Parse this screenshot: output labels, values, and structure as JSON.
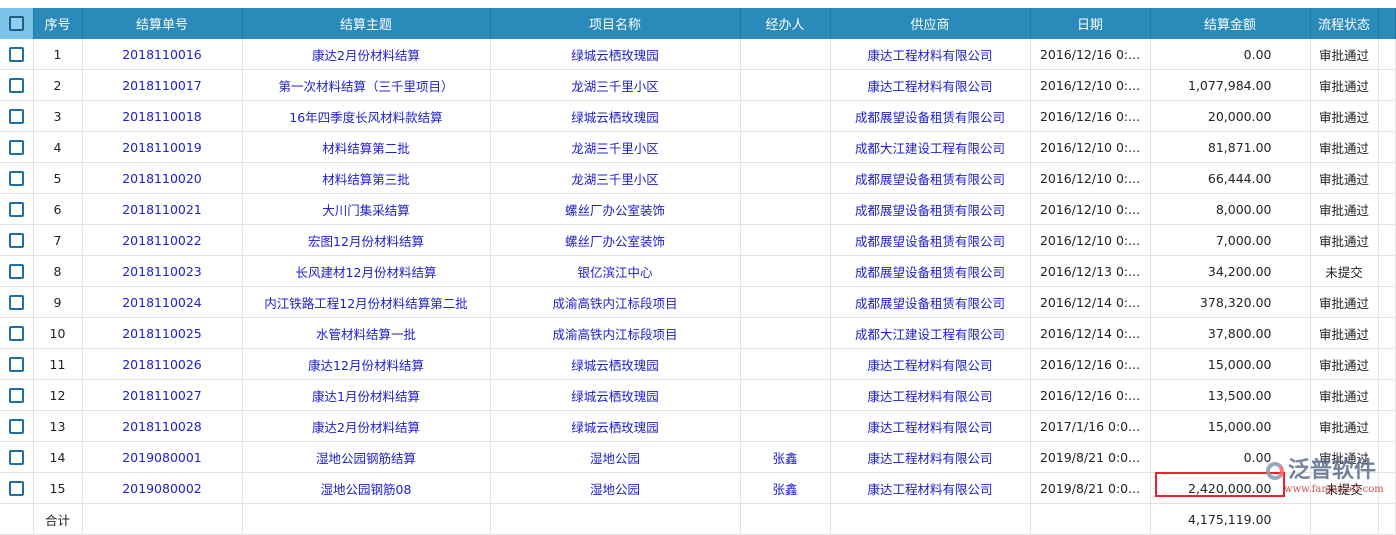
{
  "columns": [
    "序号",
    "结算单号",
    "结算主题",
    "项目名称",
    "经办人",
    "供应商",
    "日期",
    "结算金额",
    "流程状态"
  ],
  "rows": [
    [
      "1",
      "2018110016",
      "康达2月份材料结算",
      "绿城云栖玫瑰园",
      "",
      "康达工程材料有限公司",
      "2016/12/16 0:...",
      "0.00",
      "审批通过"
    ],
    [
      "2",
      "2018110017",
      "第一次材料结算（三千里项目）",
      "龙湖三千里小区",
      "",
      "康达工程材料有限公司",
      "2016/12/10 0:...",
      "1,077,984.00",
      "审批通过"
    ],
    [
      "3",
      "2018110018",
      "16年四季度长风材料款结算",
      "绿城云栖玫瑰园",
      "",
      "成都展望设备租赁有限公司",
      "2016/12/16 0:...",
      "20,000.00",
      "审批通过"
    ],
    [
      "4",
      "2018110019",
      "材料结算第二批",
      "龙湖三千里小区",
      "",
      "成都大江建设工程有限公司",
      "2016/12/10 0:...",
      "81,871.00",
      "审批通过"
    ],
    [
      "5",
      "2018110020",
      "材料结算第三批",
      "龙湖三千里小区",
      "",
      "成都展望设备租赁有限公司",
      "2016/12/10 0:...",
      "66,444.00",
      "审批通过"
    ],
    [
      "6",
      "2018110021",
      "大川门集采结算",
      "螺丝厂办公室装饰",
      "",
      "成都展望设备租赁有限公司",
      "2016/12/10 0:...",
      "8,000.00",
      "审批通过"
    ],
    [
      "7",
      "2018110022",
      "宏图12月份材料结算",
      "螺丝厂办公室装饰",
      "",
      "成都展望设备租赁有限公司",
      "2016/12/10 0:...",
      "7,000.00",
      "审批通过"
    ],
    [
      "8",
      "2018110023",
      "长风建材12月份材料结算",
      "银亿滨江中心",
      "",
      "成都展望设备租赁有限公司",
      "2016/12/13 0:...",
      "34,200.00",
      "未提交"
    ],
    [
      "9",
      "2018110024",
      "内江铁路工程12月份材料结算第二批",
      "成渝高铁内江标段项目",
      "",
      "成都展望设备租赁有限公司",
      "2016/12/14 0:...",
      "378,320.00",
      "审批通过"
    ],
    [
      "10",
      "2018110025",
      "水管材料结算一批",
      "成渝高铁内江标段项目",
      "",
      "成都大江建设工程有限公司",
      "2016/12/14 0:...",
      "37,800.00",
      "审批通过"
    ],
    [
      "11",
      "2018110026",
      "康达12月份材料结算",
      "绿城云栖玫瑰园",
      "",
      "康达工程材料有限公司",
      "2016/12/16 0:...",
      "15,000.00",
      "审批通过"
    ],
    [
      "12",
      "2018110027",
      "康达1月份材料结算",
      "绿城云栖玫瑰园",
      "",
      "康达工程材料有限公司",
      "2016/12/16 0:...",
      "13,500.00",
      "审批通过"
    ],
    [
      "13",
      "2018110028",
      "康达2月份材料结算",
      "绿城云栖玫瑰园",
      "",
      "康达工程材料有限公司",
      "2017/1/16 0:0...",
      "15,000.00",
      "审批通过"
    ],
    [
      "14",
      "2019080001",
      "湿地公园钢筋结算",
      "湿地公园",
      "张鑫",
      "康达工程材料有限公司",
      "2019/8/21 0:0...",
      "0.00",
      "审批通过"
    ],
    [
      "15",
      "2019080002",
      "湿地公园钢筋08",
      "湿地公园",
      "张鑫",
      "康达工程材料有限公司",
      "2019/8/21 0:0...",
      "2,420,000.00",
      "未提交"
    ]
  ],
  "total": {
    "label": "合计",
    "amount": "4,175,119.00"
  },
  "logo": {
    "text": "泛普软件",
    "url": "www.fanpusoft.com"
  },
  "colors": {
    "header": "#2a8bba",
    "link": "#2020cc",
    "highlight": "#e8262a"
  }
}
